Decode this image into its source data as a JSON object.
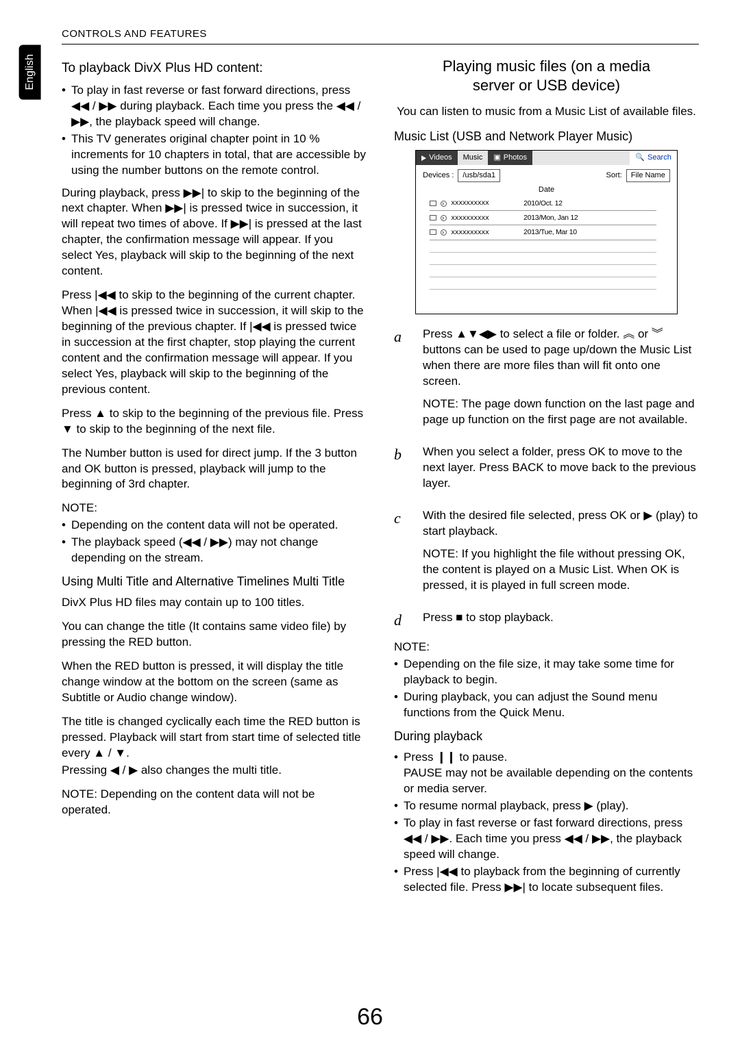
{
  "header": "CONTROLS AND FEATURES",
  "lang_tab": "English",
  "left": {
    "subhead1": "To playback DivX Plus HD content:",
    "bullets1": [
      "To play in fast reverse or fast forward directions, press ◀◀ / ▶▶ during playback. Each time you press the ◀◀ / ▶▶, the playback speed will change.",
      "This TV generates original chapter point in 10 % increments for 10 chapters in total, that are accessible by using the number buttons on the remote control."
    ],
    "p1": "During playback, press ▶▶| to skip to the beginning of the next chapter. When ▶▶| is pressed twice in succession, it will repeat two times of above. If ▶▶| is pressed at the last chapter, the confirmation message will appear. If you select Yes, playback will skip to the beginning of the next content.",
    "p2": "Press |◀◀ to skip to the beginning of the current chapter. When |◀◀ is pressed twice in succession, it will skip to the beginning of the previous chapter. If |◀◀ is pressed twice in succession at the first chapter, stop playing the current content and the confirmation message will appear. If you select Yes, playback will skip to the beginning of the previous content.",
    "p3": "Press ▲ to skip to the beginning of the previous file. Press ▼ to skip to the beginning of the next file.",
    "p4": "The Number button is used for direct jump. If the 3 button and OK button is pressed, playback will jump to the beginning of 3rd chapter.",
    "note_label": "NOTE:",
    "bullets2": [
      "Depending on the content data will not be operated.",
      "The playback speed (◀◀ / ▶▶) may not change depending on the stream."
    ],
    "subhead2": "Using Multi Title and Alternative Timelines Multi Title",
    "p5": "DivX Plus HD files may contain up to 100 titles.",
    "p6": "You can change the title (It contains same video file) by pressing the RED button.",
    "p7": "When the RED button is pressed, it will display the title change window at the bottom on the screen (same as Subtitle or Audio change window).",
    "p8": "The title is changed cyclically each time the RED button is pressed. Playback will start from start time of selected title every ▲ / ▼.",
    "p8b": "Pressing ◀ / ▶ also changes the multi title.",
    "p9": "NOTE: Depending on the content data will not be operated."
  },
  "right": {
    "section_title_l1": "Playing music files (on a media",
    "section_title_l2": "server or USB device)",
    "intro": "You can listen to music from a Music List of available files.",
    "listhead": "Music List (USB and Network Player Music)",
    "box": {
      "tab_videos": "Videos",
      "tab_music": "Music",
      "tab_photos": "Photos",
      "tab_search": "Search",
      "devices_label": "Devices :",
      "devices_value": "/usb/sda1",
      "sort_label": "Sort:",
      "sort_value": "File Name",
      "date_label": "Date",
      "rows": [
        {
          "name": "xxxxxxxxxx",
          "date": "2010/Oct. 12"
        },
        {
          "name": "xxxxxxxxxx",
          "date": "2013/Mon, Jan 12"
        },
        {
          "name": "xxxxxxxxxx",
          "date": "2013/Tue, Mar 10"
        }
      ]
    },
    "steps": [
      {
        "l": "a",
        "body": "Press ▲▼◀▶ to select a file or folder. ︽ or ︾ buttons can be used to page up/down the Music List when there are more files than will fit onto one screen.",
        "note": "NOTE: The page down function on the last page and page up function on the first page are not available."
      },
      {
        "l": "b",
        "body": "When you select a folder, press OK to move to the next layer. Press BACK to move back to the previous layer."
      },
      {
        "l": "c",
        "body": "With the desired file selected, press OK or ▶ (play) to start playback.",
        "note": "NOTE: If you highlight the file without pressing OK, the content is played on a Music List. When OK is pressed, it is played in full screen mode."
      },
      {
        "l": "d",
        "body": "Press ■ to stop playback."
      }
    ],
    "note_label": "NOTE:",
    "notes": [
      "Depending on the file size, it may take some time for playback to begin.",
      "During playback, you can adjust the Sound menu functions from the Quick Menu."
    ],
    "during_head": "During playback",
    "during": [
      "Press ❙❙ to pause.\nPAUSE may not be available depending on the contents or media server.",
      "To resume normal playback, press ▶ (play).",
      "To play in fast reverse or fast forward directions, press ◀◀ / ▶▶. Each time you press ◀◀ / ▶▶, the playback speed will change.",
      "Press |◀◀ to playback from the beginning of currently selected file. Press ▶▶| to locate subsequent files."
    ]
  },
  "page_number": "66"
}
